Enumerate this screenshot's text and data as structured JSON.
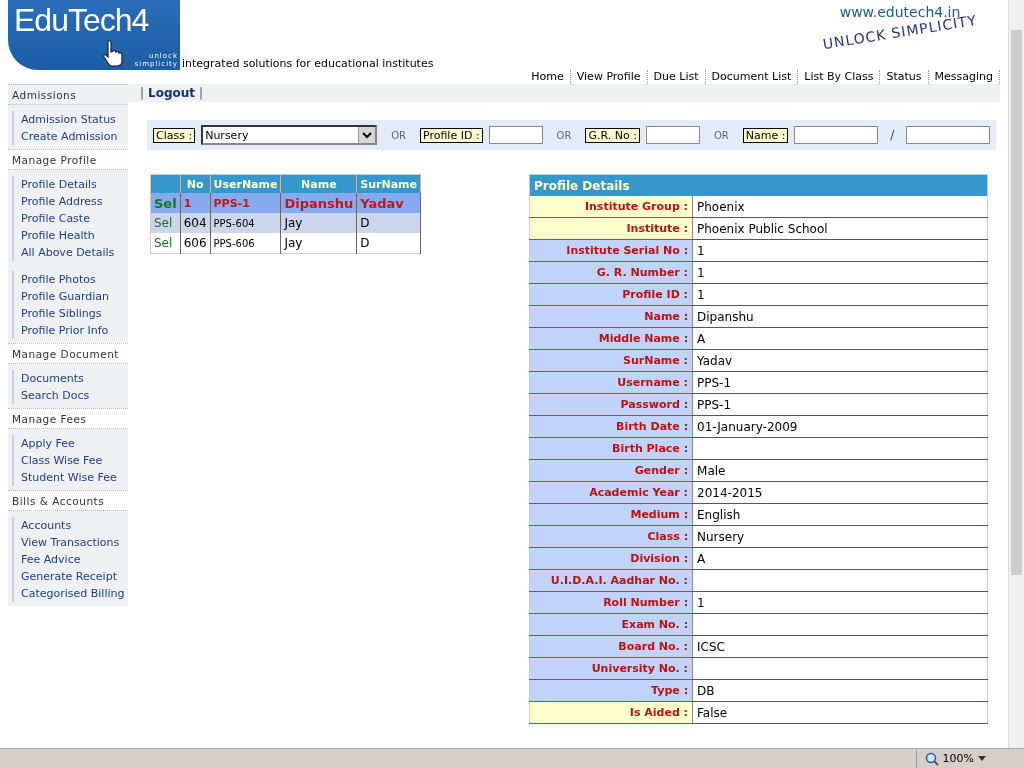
{
  "header": {
    "logo_text": "EduTech4",
    "logo_sub1": "unlock",
    "logo_sub2": "simplicity",
    "tagline": "integrated solutions for educational institutes",
    "website": "www.edutech4.in",
    "slogan": "UNLOCK SIMPLICITY"
  },
  "nav": [
    "Home",
    "View Profile",
    "Due List",
    "Document List",
    "List By Class",
    "Status",
    "Messaging"
  ],
  "logout_bar": {
    "sep_left": "|",
    "logout": "Logout",
    "sep_right": "|"
  },
  "sidebar": [
    {
      "title": "Admissions",
      "items": [
        [
          "Admission Status",
          "Create Admission"
        ]
      ]
    },
    {
      "title": "Manage Profile",
      "items": [
        [
          "Profile Details",
          "Profile Address",
          "Profile Caste",
          "Profile Health",
          "All Above Details"
        ],
        [
          "Profile Photos",
          "Profile Guardian",
          "Profile Siblings",
          "Profile Prior Info"
        ]
      ]
    },
    {
      "title": "Manage Document",
      "items": [
        [
          "Documents",
          "Search Docs"
        ]
      ]
    },
    {
      "title": "Manage Fees",
      "items": [
        [
          "Apply Fee",
          "Class Wise Fee",
          "Student Wise Fee"
        ]
      ]
    },
    {
      "title": "Bills & Accounts",
      "items": [
        [
          "Accounts",
          "View Transactions",
          "Fee Advice",
          "Generate Receipt",
          "Categorised Billing"
        ]
      ]
    }
  ],
  "search": {
    "class_label": "Class :",
    "class_value": "Nursery",
    "or_1": "OR",
    "profile_id_label": "Profile ID :",
    "or_2": "OR",
    "gr_label": "G.R. No :",
    "or_3": "OR",
    "name_label": "Name :",
    "name_sep": "/"
  },
  "students": {
    "columns": [
      "No",
      "UserName",
      "Name",
      "SurName"
    ],
    "rows": [
      {
        "sel": "Sel",
        "no": "1",
        "username": "PPS-1",
        "name": "Dipanshu",
        "surname": "Yadav",
        "selected": true
      },
      {
        "sel": "Sel",
        "no": "604",
        "username": "PPS-604",
        "name": "Jay",
        "surname": "D",
        "selected": false
      },
      {
        "sel": "Sel",
        "no": "606",
        "username": "PPS-606",
        "name": "Jay",
        "surname": "D",
        "selected": false
      }
    ]
  },
  "details": {
    "title": "Profile Details",
    "rows": [
      {
        "label": "Institute Group :",
        "value": "Phoenix",
        "kind": "highlight"
      },
      {
        "label": "Institute :",
        "value": "Phoenix Public School",
        "kind": "highlight"
      },
      {
        "label": "Institute Serial No :",
        "value": "1",
        "kind": "normal"
      },
      {
        "label": "G. R. Number :",
        "value": "1",
        "kind": "normal"
      },
      {
        "label": "Profile ID :",
        "value": "1",
        "kind": "normal"
      },
      {
        "label": "Name :",
        "value": "Dipanshu",
        "kind": "normal"
      },
      {
        "label": "Middle Name :",
        "value": "A",
        "kind": "normal"
      },
      {
        "label": "SurName :",
        "value": "Yadav",
        "kind": "normal"
      },
      {
        "label": "Username :",
        "value": "PPS-1",
        "kind": "normal"
      },
      {
        "label": "Password :",
        "value": "PPS-1",
        "kind": "normal"
      },
      {
        "label": "Birth Date :",
        "value": "01-January-2009",
        "kind": "normal"
      },
      {
        "label": "Birth Place :",
        "kind": "normal"
      },
      {
        "label": "Gender :",
        "value": "Male",
        "kind": "normal"
      },
      {
        "label": "Academic Year :",
        "value": "2014-2015",
        "kind": "normal"
      },
      {
        "label": "Medium :",
        "value": "English",
        "kind": "normal"
      },
      {
        "label": "Class :",
        "value": "Nursery",
        "kind": "normal"
      },
      {
        "label": "Division :",
        "value": "A",
        "kind": "normal"
      },
      {
        "label": "U.I.D.A.I. Aadhar No. :",
        "kind": "normal"
      },
      {
        "label": "Roll Number :",
        "value": "1",
        "kind": "normal"
      },
      {
        "label": "Exam No. :",
        "kind": "normal"
      },
      {
        "label": "Board No. :",
        "value": "ICSC",
        "kind": "normal"
      },
      {
        "label": "University No. :",
        "kind": "normal"
      },
      {
        "label": "Type :",
        "value": "DB",
        "kind": "normal"
      },
      {
        "label": "Is Aided :",
        "value": "False",
        "kind": "highlight"
      }
    ]
  },
  "status_bar": {
    "zoom": "100%"
  }
}
